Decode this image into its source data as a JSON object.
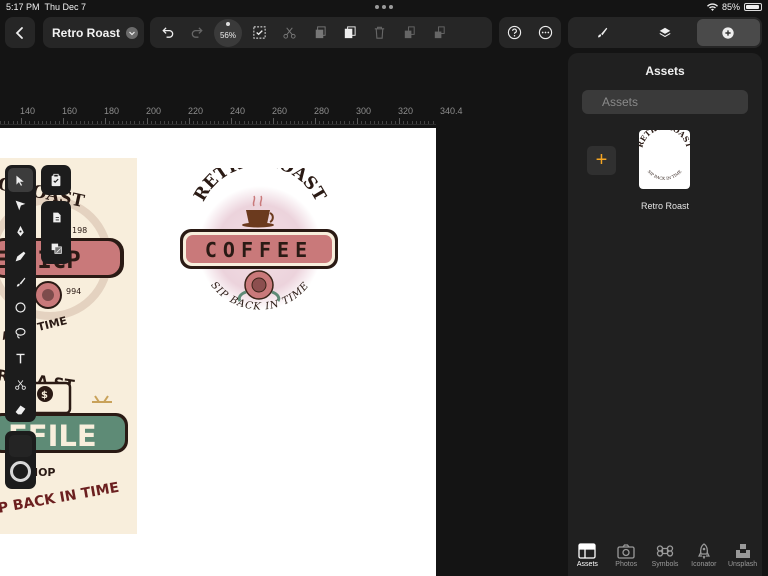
{
  "status": {
    "time": "5:17 PM",
    "date": "Thu Dec 7",
    "battery": "85%"
  },
  "toolbar": {
    "doc_title": "Retro Roast",
    "zoom": "56%"
  },
  "ruler": {
    "labels": [
      "140",
      "160",
      "180",
      "200",
      "220",
      "240",
      "260",
      "280",
      "300",
      "320",
      "340.4"
    ]
  },
  "canvas": {
    "logo_top": "RETRO ROAST",
    "logo_banner": "COFFEE",
    "logo_bottom": "SIP BACK IN TIME",
    "artboard_texts": {
      "t1": "O ROAST",
      "t2": "198",
      "t3": "EE ICP",
      "t4": "994",
      "t5": "ACK I TIME",
      "t6": "R RAA ST",
      "t7": "FFILE",
      "t8": "EE HOP",
      "t9": "P BACK IN TIME"
    }
  },
  "panel": {
    "title": "Assets",
    "search_placeholder": "Assets",
    "asset_name": "Retro Roast",
    "asset_thumb_top": "RETRO ROAST",
    "asset_thumb_bottom": "SIP BACK IN TIME",
    "tabs": [
      "Assets",
      "Photos",
      "Symbols",
      "Iconator",
      "Unsplash"
    ]
  },
  "colors": {
    "accent": "#f5a623",
    "banner": "#c9797a",
    "panel": "#202020"
  }
}
